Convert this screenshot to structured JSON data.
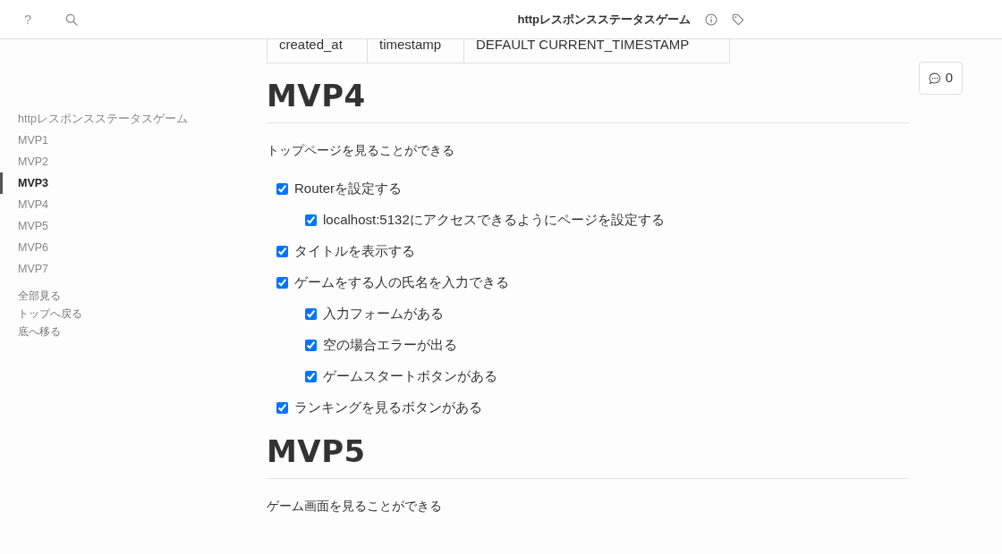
{
  "topbar": {
    "help": "?",
    "title": "httpレスポンスステータスゲーム"
  },
  "toc": {
    "items": [
      {
        "label": "httpレスポンスステータスゲーム",
        "selected": false
      },
      {
        "label": "MVP1",
        "selected": false
      },
      {
        "label": "MVP2",
        "selected": false
      },
      {
        "label": "MVP3",
        "selected": true
      },
      {
        "label": "MVP4",
        "selected": false
      },
      {
        "label": "MVP5",
        "selected": false
      },
      {
        "label": "MVP6",
        "selected": false
      },
      {
        "label": "MVP7",
        "selected": false
      }
    ],
    "links": [
      "全部見る",
      "トップへ戻る",
      "底へ移る"
    ]
  },
  "table": {
    "rows": [
      [
        "created_at",
        "timestamp",
        "DEFAULT CURRENT_TIMESTAMP"
      ]
    ]
  },
  "comment_button": {
    "count": "0"
  },
  "sections": [
    {
      "heading": "MVP4",
      "text": "トップページを見ることができる",
      "tasks": [
        {
          "label": "Routerを設定する",
          "checked": true,
          "children": [
            {
              "label": "localhost:5132にアクセスできるようにページを設定する",
              "checked": true
            }
          ]
        },
        {
          "label": "タイトルを表示する",
          "checked": true
        },
        {
          "label": "ゲームをする人の氏名を入力できる",
          "checked": true,
          "children": [
            {
              "label": "入力フォームがある",
              "checked": true
            },
            {
              "label": "空の場合エラーが出る",
              "checked": true
            },
            {
              "label": "ゲームスタートボタンがある",
              "checked": true
            }
          ]
        },
        {
          "label": "ランキングを見るボタンがある",
          "checked": true
        }
      ]
    },
    {
      "heading": "MVP5",
      "text": "ゲーム画面を見ることができる"
    }
  ]
}
